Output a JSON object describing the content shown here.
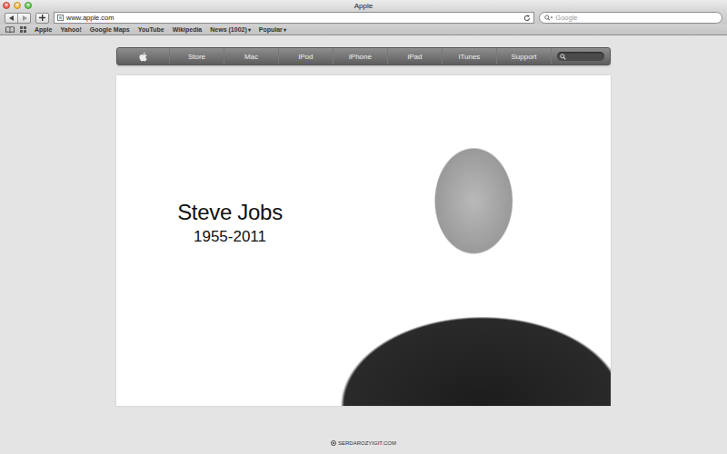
{
  "window": {
    "title": "Apple"
  },
  "toolbar": {
    "url": "www.apple.com",
    "search": {
      "placeholder": "Google"
    }
  },
  "bookmarks": [
    {
      "label": "Apple",
      "menu": ""
    },
    {
      "label": "Yahoo!",
      "menu": ""
    },
    {
      "label": "Google Maps",
      "menu": ""
    },
    {
      "label": "YouTube",
      "menu": ""
    },
    {
      "label": "Wikipedia",
      "menu": ""
    },
    {
      "label": "News (1002)",
      "menu": "▾"
    },
    {
      "label": "Popular",
      "menu": "▾"
    }
  ],
  "nav": {
    "items": [
      "Store",
      "Mac",
      "iPod",
      "iPhone",
      "iPad",
      "iTunes",
      "Support"
    ]
  },
  "hero": {
    "title": "Steve Jobs",
    "dates": "1955-2011"
  },
  "footer": {
    "credit": "SERDAROZYIGIT.COM"
  }
}
